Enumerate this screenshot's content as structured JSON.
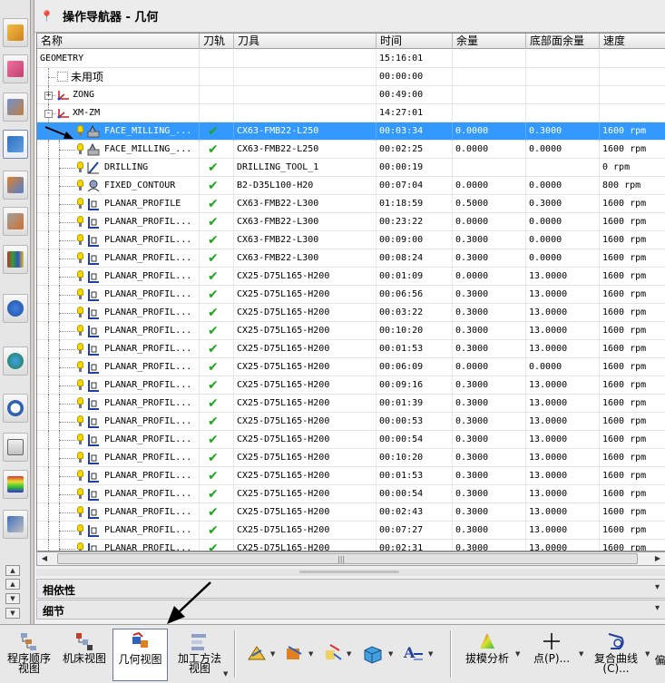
{
  "navigator": {
    "title": "操作导航器 - 几何",
    "columns": [
      "名称",
      "刀轨",
      "刀具",
      "时间",
      "余量",
      "底部面余量",
      "速度"
    ],
    "rows": [
      {
        "name": "GEOMETRY",
        "toolpath": "",
        "tool": "",
        "time": "15:16:01",
        "stock": "",
        "floor_stock": "",
        "speed": "",
        "level": 0,
        "kind": "root"
      },
      {
        "name": "未用项",
        "toolpath": "",
        "tool": "",
        "time": "00:00:00",
        "stock": "",
        "floor_stock": "",
        "speed": "",
        "level": 1,
        "kind": "unused"
      },
      {
        "name": "ZONG",
        "toolpath": "",
        "tool": "",
        "time": "00:49:00",
        "stock": "",
        "floor_stock": "",
        "speed": "",
        "level": 1,
        "kind": "mcs",
        "expander": "+"
      },
      {
        "name": "XM-ZM",
        "toolpath": "",
        "tool": "",
        "time": "14:27:01",
        "stock": "",
        "floor_stock": "",
        "speed": "",
        "level": 1,
        "kind": "mcs",
        "expander": "−"
      },
      {
        "name": "FACE_MILLING_...",
        "toolpath": "✔",
        "tool": "CX63-FMB22-L250",
        "time": "00:03:34",
        "stock": "0.0000",
        "floor_stock": "0.3000",
        "speed": "1600 rpm",
        "level": 2,
        "kind": "face",
        "selected": true
      },
      {
        "name": "FACE_MILLING_...",
        "toolpath": "✔",
        "tool": "CX63-FMB22-L250",
        "time": "00:02:25",
        "stock": "0.0000",
        "floor_stock": "0.0000",
        "speed": "1600 rpm",
        "level": 2,
        "kind": "face"
      },
      {
        "name": "DRILLING",
        "toolpath": "✔",
        "tool": "DRILLING_TOOL_1",
        "time": "00:00:19",
        "stock": "",
        "floor_stock": "",
        "speed": "0 rpm",
        "level": 2,
        "kind": "drill"
      },
      {
        "name": "FIXED_CONTOUR",
        "toolpath": "✔",
        "tool": "B2-D35L100-H20",
        "time": "00:07:04",
        "stock": "0.0000",
        "floor_stock": "0.0000",
        "speed": "800 rpm",
        "level": 2,
        "kind": "contour"
      },
      {
        "name": "PLANAR_PROFILE",
        "toolpath": "✔",
        "tool": "CX63-FMB22-L300",
        "time": "01:18:59",
        "stock": "0.5000",
        "floor_stock": "0.3000",
        "speed": "1600 rpm",
        "level": 2,
        "kind": "planar"
      },
      {
        "name": "PLANAR_PROFIL...",
        "toolpath": "✔",
        "tool": "CX63-FMB22-L300",
        "time": "00:23:22",
        "stock": "0.0000",
        "floor_stock": "0.0000",
        "speed": "1600 rpm",
        "level": 2,
        "kind": "planar"
      },
      {
        "name": "PLANAR_PROFIL...",
        "toolpath": "✔",
        "tool": "CX63-FMB22-L300",
        "time": "00:09:00",
        "stock": "0.3000",
        "floor_stock": "0.0000",
        "speed": "1600 rpm",
        "level": 2,
        "kind": "planar"
      },
      {
        "name": "PLANAR_PROFIL...",
        "toolpath": "✔",
        "tool": "CX63-FMB22-L300",
        "time": "00:08:24",
        "stock": "0.3000",
        "floor_stock": "0.0000",
        "speed": "1600 rpm",
        "level": 2,
        "kind": "planar"
      },
      {
        "name": "PLANAR_PROFIL...",
        "toolpath": "✔",
        "tool": "CX25-D75L165-H200",
        "time": "00:01:09",
        "stock": "0.0000",
        "floor_stock": "13.0000",
        "speed": "1600 rpm",
        "level": 2,
        "kind": "planar"
      },
      {
        "name": "PLANAR_PROFIL...",
        "toolpath": "✔",
        "tool": "CX25-D75L165-H200",
        "time": "00:06:56",
        "stock": "0.3000",
        "floor_stock": "13.0000",
        "speed": "1600 rpm",
        "level": 2,
        "kind": "planar"
      },
      {
        "name": "PLANAR_PROFIL...",
        "toolpath": "✔",
        "tool": "CX25-D75L165-H200",
        "time": "00:03:22",
        "stock": "0.3000",
        "floor_stock": "13.0000",
        "speed": "1600 rpm",
        "level": 2,
        "kind": "planar"
      },
      {
        "name": "PLANAR_PROFIL...",
        "toolpath": "✔",
        "tool": "CX25-D75L165-H200",
        "time": "00:10:20",
        "stock": "0.3000",
        "floor_stock": "13.0000",
        "speed": "1600 rpm",
        "level": 2,
        "kind": "planar"
      },
      {
        "name": "PLANAR_PROFIL...",
        "toolpath": "✔",
        "tool": "CX25-D75L165-H200",
        "time": "00:01:53",
        "stock": "0.3000",
        "floor_stock": "13.0000",
        "speed": "1600 rpm",
        "level": 2,
        "kind": "planar"
      },
      {
        "name": "PLANAR_PROFIL...",
        "toolpath": "✔",
        "tool": "CX25-D75L165-H200",
        "time": "00:06:09",
        "stock": "0.0000",
        "floor_stock": "0.0000",
        "speed": "1600 rpm",
        "level": 2,
        "kind": "planar"
      },
      {
        "name": "PLANAR_PROFIL...",
        "toolpath": "✔",
        "tool": "CX25-D75L165-H200",
        "time": "00:09:16",
        "stock": "0.3000",
        "floor_stock": "13.0000",
        "speed": "1600 rpm",
        "level": 2,
        "kind": "planar"
      },
      {
        "name": "PLANAR_PROFIL...",
        "toolpath": "✔",
        "tool": "CX25-D75L165-H200",
        "time": "00:01:39",
        "stock": "0.3000",
        "floor_stock": "13.0000",
        "speed": "1600 rpm",
        "level": 2,
        "kind": "planar"
      },
      {
        "name": "PLANAR_PROFIL...",
        "toolpath": "✔",
        "tool": "CX25-D75L165-H200",
        "time": "00:00:53",
        "stock": "0.3000",
        "floor_stock": "13.0000",
        "speed": "1600 rpm",
        "level": 2,
        "kind": "planar"
      },
      {
        "name": "PLANAR_PROFIL...",
        "toolpath": "✔",
        "tool": "CX25-D75L165-H200",
        "time": "00:00:54",
        "stock": "0.3000",
        "floor_stock": "13.0000",
        "speed": "1600 rpm",
        "level": 2,
        "kind": "planar"
      },
      {
        "name": "PLANAR_PROFIL...",
        "toolpath": "✔",
        "tool": "CX25-D75L165-H200",
        "time": "00:10:20",
        "stock": "0.3000",
        "floor_stock": "13.0000",
        "speed": "1600 rpm",
        "level": 2,
        "kind": "planar"
      },
      {
        "name": "PLANAR_PROFIL...",
        "toolpath": "✔",
        "tool": "CX25-D75L165-H200",
        "time": "00:01:53",
        "stock": "0.3000",
        "floor_stock": "13.0000",
        "speed": "1600 rpm",
        "level": 2,
        "kind": "planar"
      },
      {
        "name": "PLANAR_PROFIL...",
        "toolpath": "✔",
        "tool": "CX25-D75L165-H200",
        "time": "00:00:54",
        "stock": "0.3000",
        "floor_stock": "13.0000",
        "speed": "1600 rpm",
        "level": 2,
        "kind": "planar"
      },
      {
        "name": "PLANAR_PROFIL...",
        "toolpath": "✔",
        "tool": "CX25-D75L165-H200",
        "time": "00:02:43",
        "stock": "0.3000",
        "floor_stock": "13.0000",
        "speed": "1600 rpm",
        "level": 2,
        "kind": "planar"
      },
      {
        "name": "PLANAR_PROFIL...",
        "toolpath": "✔",
        "tool": "CX25-D75L165-H200",
        "time": "00:07:27",
        "stock": "0.3000",
        "floor_stock": "13.0000",
        "speed": "1600 rpm",
        "level": 2,
        "kind": "planar"
      },
      {
        "name": "PLANAR_PROFIL...",
        "toolpath": "✔",
        "tool": "CX25-D75L165-H200",
        "time": "00:02:31",
        "stock": "0.3000",
        "floor_stock": "13.0000",
        "speed": "1600 rpm",
        "level": 2,
        "kind": "planar"
      }
    ],
    "sections": {
      "dependencies": "相依性",
      "details": "细节"
    }
  },
  "bottom_toolbar": {
    "program_order_view": [
      "程序顺序",
      "视图"
    ],
    "machine_tool_view": "机床视图",
    "geometry_view": "几何视图",
    "machining_method_view": [
      "加工方法",
      "视图"
    ],
    "draft_analysis": "拔模分析",
    "point": "点(P)...",
    "composite_curve": [
      "复合曲线",
      "(C)..."
    ],
    "overflow": "偏"
  },
  "left_toolbar_icons": [
    "assembly-navigator-icon",
    "constraint-navigator-icon",
    "part-navigator-icon",
    "operation-navigator-icon",
    "machine-tool-navigator-icon",
    "tool-library-icon",
    "resource-library-icon",
    "info-icon",
    "web-browser-icon",
    "history-icon",
    "system-materials-icon",
    "color-palette-icon",
    "roles-icon"
  ],
  "colors": {
    "selection": "#3399ff",
    "check": "#1aa61a",
    "bulb": "#f5d800",
    "arrow": "#000000"
  }
}
